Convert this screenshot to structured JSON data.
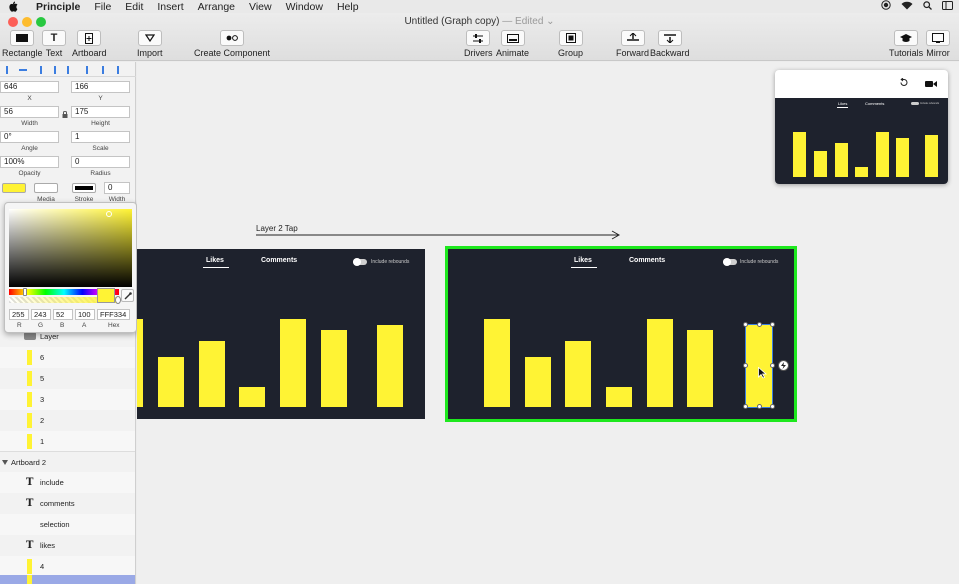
{
  "menubar": {
    "app_name": "Principle",
    "items": [
      "File",
      "Edit",
      "Insert",
      "Arrange",
      "View",
      "Window",
      "Help"
    ]
  },
  "window": {
    "title": "Untitled (Graph copy)",
    "edited": "— Edited ⌄"
  },
  "toolbar": {
    "rectangle": "Rectangle",
    "text": "Text",
    "artboard": "Artboard",
    "import": "Import",
    "create_component": "Create Component",
    "drivers": "Drivers",
    "animate": "Animate",
    "group": "Group",
    "forward": "Forward",
    "backward": "Backward",
    "tutorials": "Tutorials",
    "mirror": "Mirror"
  },
  "inspector": {
    "x": "646",
    "x_label": "X",
    "y": "166",
    "y_label": "Y",
    "width": "56",
    "width_label": "Width",
    "height": "175",
    "height_label": "Height",
    "angle": "0°",
    "angle_label": "Angle",
    "scale": "1",
    "scale_label": "Scale",
    "opacity": "100%",
    "opacity_label": "Opacity",
    "radius": "0",
    "radius_label": "Radius",
    "fill_color": "#fff334",
    "media_label": "Media",
    "stroke_label": "Stroke",
    "stroke_width": "0",
    "stroke_width_label": "Width"
  },
  "color_picker": {
    "r": "255",
    "g": "243",
    "b": "52",
    "a": "100",
    "hex": "FFF334",
    "r_label": "R",
    "g_label": "G",
    "b_label": "B",
    "a_label": "A",
    "hex_label": "Hex"
  },
  "layers": {
    "group_label": "Layer",
    "artboard1_bars": [
      "6",
      "5",
      "3",
      "2",
      "1"
    ],
    "artboard2_label": "Artboard 2",
    "artboard2_items": [
      {
        "name": "include",
        "type": "text"
      },
      {
        "name": "comments",
        "type": "text"
      },
      {
        "name": "selection",
        "type": "shape"
      },
      {
        "name": "likes",
        "type": "text"
      },
      {
        "name": "4",
        "type": "bar"
      }
    ]
  },
  "canvas": {
    "transition_label": "Layer 2 Tap",
    "tab_likes": "Likes",
    "tab_comments": "Comments",
    "include_rebounds": "Include rebounds",
    "accent_yellow": "#fff334",
    "artboard_bg": "#1e222d",
    "selection_green": "#1ee81e"
  }
}
